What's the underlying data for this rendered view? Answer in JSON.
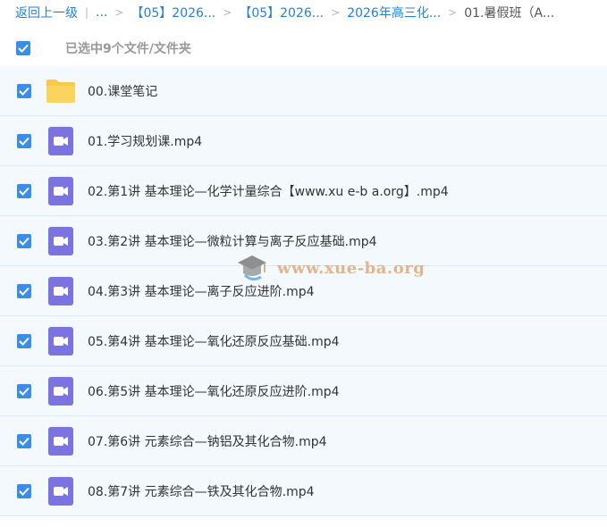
{
  "breadcrumb": {
    "back": "返回上一级",
    "ellipsis": "...",
    "items": [
      "【05】2026...",
      "【05】2026...",
      "2026年高三化..."
    ],
    "current": "01.暑假班（A..."
  },
  "selection": {
    "count_label": "已选中9个文件/文件夹",
    "all_checked": true
  },
  "files": [
    {
      "name": "00.课堂笔记",
      "type": "folder-icon",
      "checked": true
    },
    {
      "name": "01.学习规划课.mp4",
      "type": "video-icon",
      "checked": true
    },
    {
      "name": "02.第1讲 基本理论—化学计量综合【www.xu e-b a.org】.mp4",
      "type": "video-icon",
      "checked": true
    },
    {
      "name": "03.第2讲 基本理论—微粒计算与离子反应基础.mp4",
      "type": "video-icon",
      "checked": true
    },
    {
      "name": "04.第3讲 基本理论—离子反应进阶.mp4",
      "type": "video-icon",
      "checked": true
    },
    {
      "name": "05.第4讲 基本理论—氧化还原反应基础.mp4",
      "type": "video-icon",
      "checked": true
    },
    {
      "name": "06.第5讲 基本理论—氧化还原反应进阶.mp4",
      "type": "video-icon",
      "checked": true
    },
    {
      "name": "07.第6讲 元素综合—钠铝及其化合物.mp4",
      "type": "video-icon",
      "checked": true
    },
    {
      "name": "08.第7讲 元素综合—铁及其化合物.mp4",
      "type": "video-icon",
      "checked": true
    }
  ],
  "watermark": {
    "text": "www.xue-ba.org"
  },
  "colors": {
    "accent": "#3b8de8",
    "link": "#2681d6",
    "row_bg": "#f3f9fd",
    "folder": "#f9c94a",
    "video": "#7b73e2"
  }
}
